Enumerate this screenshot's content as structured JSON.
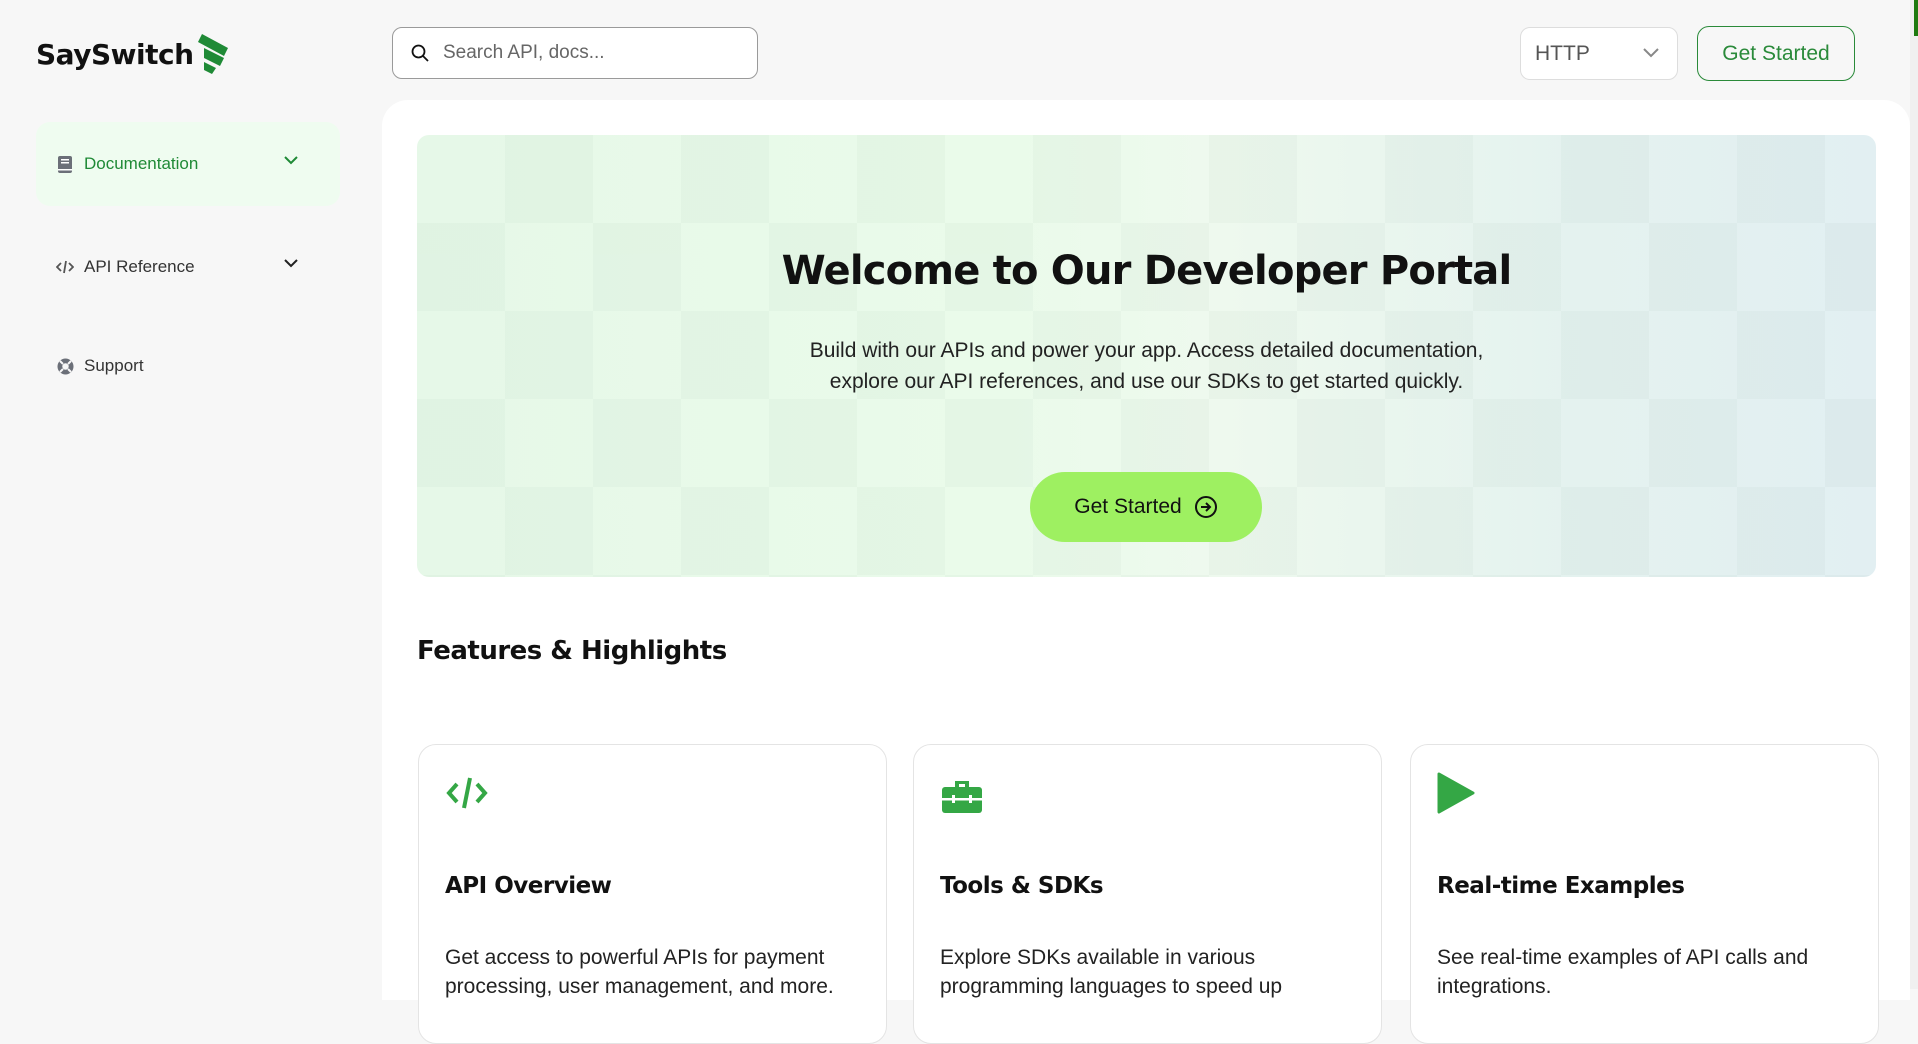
{
  "brand": {
    "name": "SaySwitch",
    "accent": "#2a8a3a"
  },
  "sidebar": {
    "items": [
      {
        "label": "Documentation",
        "icon": "book-icon",
        "active": true,
        "expandable": true
      },
      {
        "label": "API Reference",
        "icon": "code-icon",
        "active": false,
        "expandable": true
      },
      {
        "label": "Support",
        "icon": "lifebuoy-icon",
        "active": false,
        "expandable": false
      }
    ]
  },
  "header": {
    "search_placeholder": "Search API, docs...",
    "protocol_select": "HTTP",
    "get_started": "Get Started"
  },
  "hero": {
    "title": "Welcome to Our Developer Portal",
    "subtitle_line1": "Build with our APIs and power your app. Access detailed documentation,",
    "subtitle_line2": "explore our API references, and use our SDKs to get started quickly.",
    "button": "Get Started",
    "button_color": "#9ef061"
  },
  "features": {
    "heading": "Features & Highlights",
    "cards": [
      {
        "icon": "code-icon",
        "title": "API Overview",
        "desc": "Get access to powerful APIs for payment processing, user management, and more."
      },
      {
        "icon": "toolbox-icon",
        "title": "Tools & SDKs",
        "desc": "Explore SDKs available in various programming languages to speed up"
      },
      {
        "icon": "play-icon",
        "title": "Real-time Examples",
        "desc": "See real-time examples of API calls and integrations."
      }
    ]
  }
}
